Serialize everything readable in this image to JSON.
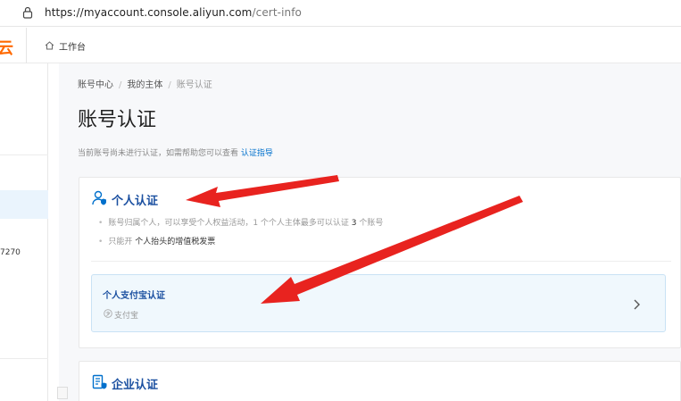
{
  "browser": {
    "url_host": "https://myaccount.console.aliyun.com",
    "url_path": "/cert-info"
  },
  "topbar": {
    "logo_fragment": "云",
    "workbench_label": "工作台"
  },
  "sidebar": {
    "id_fragment": "7270"
  },
  "breadcrumb": {
    "items": [
      "账号中心",
      "我的主体",
      "账号认证"
    ]
  },
  "page": {
    "title": "账号认证",
    "hint_text": "当前账号尚未进行认证，如需帮助您可以查看",
    "hint_link": "认证指导"
  },
  "personal": {
    "title": "个人认证",
    "bullet1_pre": "账号归属个人，可以享受个人权益活动，1 个个人主体最多可以认证",
    "bullet1_num": "3",
    "bullet1_post": "个账号",
    "bullet2_pre": "只能开",
    "bullet2_em": "个人抬头的增值税发票",
    "option_title": "个人支付宝认证",
    "option_sub": "支付宝"
  },
  "enterprise": {
    "title": "企业认证"
  },
  "colors": {
    "accent": "#0070cc",
    "arrow": "#e8231f",
    "title_blue": "#1a4fa0",
    "brand_orange": "#ff6a00"
  }
}
